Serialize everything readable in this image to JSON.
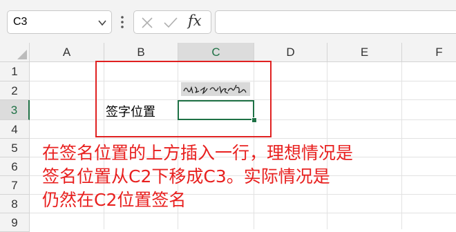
{
  "name_box": {
    "value": "C3",
    "dropdown_icon": "chevron-down-icon"
  },
  "formula_bar": {
    "menu_icon": "vertical-dots-icon",
    "cancel_icon": "x-icon",
    "enter_icon": "check-icon",
    "function_label": "fx",
    "formula_value": ""
  },
  "columns": [
    "A",
    "B",
    "C",
    "D",
    "E",
    "F"
  ],
  "selected_column": "C",
  "rows": [
    "1",
    "2",
    "3",
    "4",
    "5",
    "6",
    "7",
    "8",
    "9"
  ],
  "selected_row": "3",
  "cells": {
    "B3": "签字位置",
    "C3": ""
  },
  "annotation": {
    "lines": [
      "在签名位置的上方插入一行，理想情况是",
      "签名位置从C2下移成C3。实际情况是",
      "仍然在C2位置签名"
    ],
    "color": "#e8201f",
    "box_color": "#e02020"
  },
  "signature_text": "欧新蕾",
  "accent_color": "#1e7145"
}
